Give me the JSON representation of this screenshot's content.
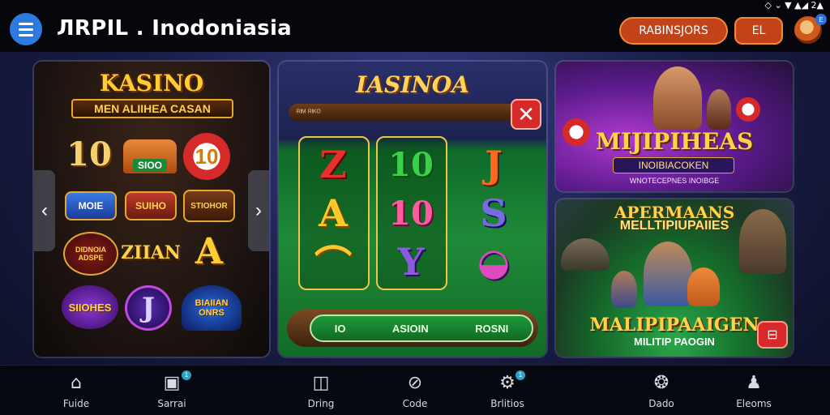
{
  "status_bar": {
    "text": "◇ ⌄ ▼ ▲◢ 2▲"
  },
  "header": {
    "title": "ЛRPIL . Inodoniasia",
    "pill_primary": "RABINSJORS",
    "pill_secondary": "EL"
  },
  "left_panel": {
    "title": "KASINO",
    "subtitle": "MEN ALIIHEA CASAN",
    "tiles": [
      "10",
      "SIOO",
      "10",
      "MOIE",
      "SUIHO",
      "STIOHOR",
      "DIDNOIA ADSPE",
      "ZIIAN",
      "A",
      "SIIOHES",
      "J",
      "BIAIIAN ONRS"
    ]
  },
  "middle_panel": {
    "title": "IASINOA",
    "wood_label": "ᴿᴵᴹ ᴿᴵᴷᴼ",
    "close_icon_label": "✕",
    "reels": [
      [
        "Z",
        "A",
        "⌒"
      ],
      [
        "10",
        "10",
        "Y"
      ],
      [
        "J",
        "S",
        "◒"
      ]
    ],
    "bet_bar": [
      "IO",
      "ASIOIN",
      "ROSNI"
    ]
  },
  "right_top_panel": {
    "title": "MIJIPIHEAS",
    "subtitle": "INOIBIACOKEN",
    "caption": "WNOTECEPNES INOIBGE"
  },
  "right_bottom_panel": {
    "title_line1": "APERMAANS",
    "title_line2": "MELLTIPIUPAIIES",
    "title_line3": "MALIPIPAAIGEN",
    "caption": "MILITIP PAOGIN"
  },
  "bottom_nav": [
    {
      "label": "Fuide",
      "icon": "home-icon",
      "badge": ""
    },
    {
      "label": "Sarrai",
      "icon": "window-icon",
      "badge": "1"
    },
    {
      "label": "Dring",
      "icon": "frame-icon",
      "badge": ""
    },
    {
      "label": "Code",
      "icon": "no-entry-icon",
      "badge": ""
    },
    {
      "label": "Brlitios",
      "icon": "gear-icon",
      "badge": "1"
    },
    {
      "label": "Dado",
      "icon": "paw-icon",
      "badge": ""
    },
    {
      "label": "Eleoms",
      "icon": "person-icon",
      "badge": ""
    }
  ],
  "colors": {
    "accent_blue": "#2e7be0",
    "pill_orange": "#c2431a",
    "gold": "#ffd24a",
    "close_red": "#d62a2a"
  }
}
